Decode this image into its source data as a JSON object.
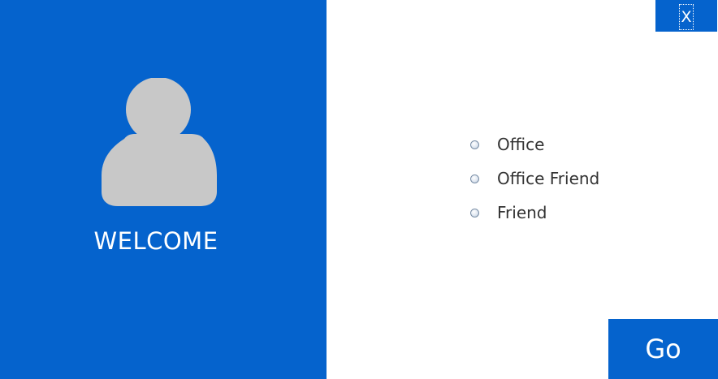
{
  "window": {
    "colors": {
      "accent": "#0563CD",
      "avatar": "#C8C8C8",
      "background": "#FFFFFF",
      "text_dark": "#333333"
    }
  },
  "left_panel": {
    "avatar_icon": "user-icon",
    "welcome_text": "WELCOME"
  },
  "close_button": {
    "label": "X"
  },
  "options": [
    {
      "label": "Office",
      "selected": false
    },
    {
      "label": "Office Friend",
      "selected": false
    },
    {
      "label": "Friend",
      "selected": false
    }
  ],
  "go_button": {
    "label": "Go"
  }
}
